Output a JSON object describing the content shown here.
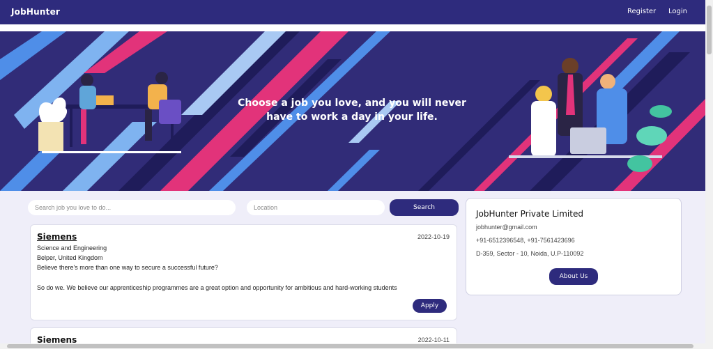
{
  "navbar": {
    "brand": "JobHunter",
    "register_label": "Register",
    "login_label": "Login"
  },
  "hero": {
    "tagline_line1": "Choose a job you love, and you will never",
    "tagline_line2": "have to work a day in your life."
  },
  "search": {
    "job_placeholder": "Search job you love to do...",
    "location_placeholder": "Location",
    "button_label": "Search"
  },
  "jobs": [
    {
      "company": "Siemens",
      "date": "2022-10-19",
      "category": "Science and Engineering",
      "location": "Belper, United Kingdom",
      "desc_line1": "Believe there's more than one way to secure a successful future?",
      "desc_line2": "So do we. We believe our apprenticeship programmes are a great option and opportunity for ambitious and hard-working students",
      "apply_label": "Apply"
    },
    {
      "company": "Siemens",
      "date": "2022-10-11"
    }
  ],
  "company_info": {
    "name": "JobHunter Private Limited",
    "email": "jobhunter@gmail.com",
    "phone": "+91-6512396548, +91-7561423696",
    "address": "D-359, Sector - 10, Noida, U.P-110092",
    "about_label": "About Us"
  },
  "colors": {
    "primary": "#2e2b7d",
    "hero_bg": "#312c78",
    "accent_pink": "#e2337a",
    "accent_blue": "#4f8ee8",
    "page_bg": "#efeef9"
  }
}
